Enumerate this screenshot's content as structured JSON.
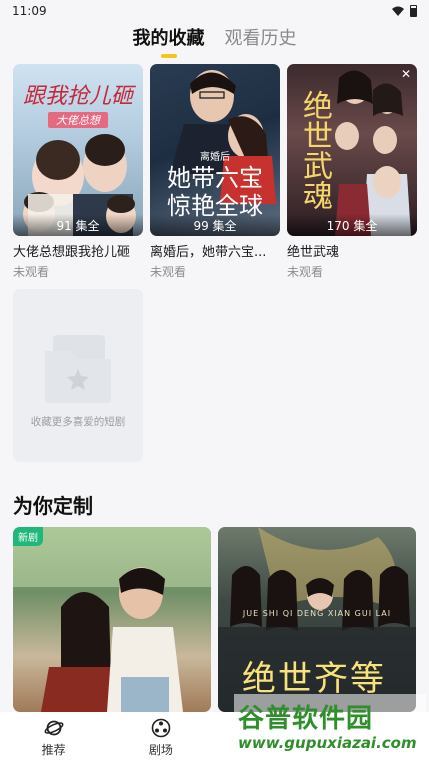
{
  "status_bar": {
    "time": "11:09"
  },
  "tabs": [
    {
      "label": "我的收藏",
      "active": true
    },
    {
      "label": "观看历史",
      "active": false
    }
  ],
  "favorites": [
    {
      "title": "大佬总想跟我抢儿砸",
      "status": "未观看",
      "episodes": "91 集全",
      "poster_text": "跟我抢儿砸",
      "poster_sub": "大佬总想"
    },
    {
      "title": "离婚后，她带六宝...",
      "status": "未观看",
      "episodes": "99 集全",
      "poster_text": "她带六宝 惊艳全球",
      "poster_sub": "离婚后"
    },
    {
      "title": "绝世武魂",
      "status": "未观看",
      "episodes": "170 集全",
      "poster_text": "绝世武魂",
      "close_icon": "close-icon"
    }
  ],
  "empty_card": {
    "text": "收藏更多喜爱的短剧"
  },
  "section": {
    "title": "为你定制"
  },
  "recommend": [
    {
      "badge": "新剧"
    },
    {
      "poster_text": "绝世齐等",
      "poster_sub": "JUE SHI QI DENG XIAN GUI LAI"
    }
  ],
  "bottom_nav": [
    {
      "label": "推荐",
      "icon": "planet-icon"
    },
    {
      "label": "剧场",
      "icon": "film-reel-icon"
    }
  ],
  "watermark": {
    "title": "谷普软件园",
    "url": "www.gupuxiazai.com"
  },
  "colors": {
    "accent": "#f5c518",
    "badge_green": "#1fb87a",
    "watermark_green": "#2f8f2a"
  }
}
